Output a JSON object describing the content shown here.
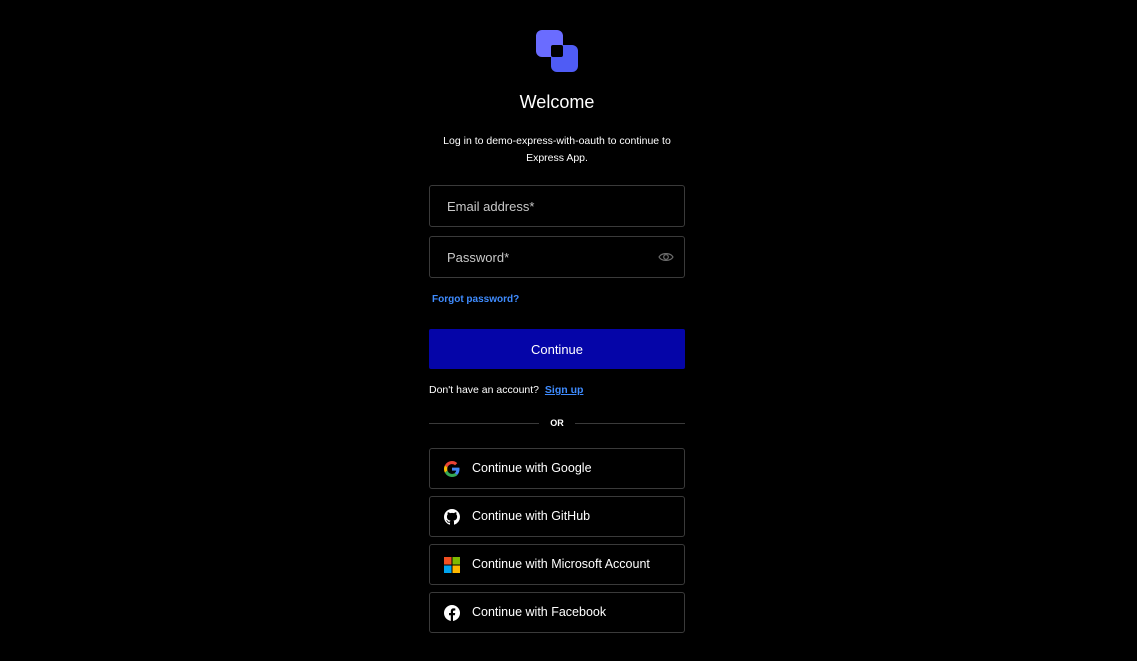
{
  "header": {
    "title": "Welcome",
    "subtitle_line1": "Log in to demo-express-with-oauth to continue to",
    "subtitle_line2": "Express App."
  },
  "form": {
    "email_placeholder": "Email address*",
    "email_value": "",
    "password_placeholder": "Password*",
    "password_value": "",
    "forgot_label": "Forgot password?",
    "continue_label": "Continue"
  },
  "signup": {
    "prompt": "Don't have an account?",
    "link_label": "Sign up"
  },
  "divider": {
    "label": "OR"
  },
  "social": {
    "google_label": "Continue with Google",
    "github_label": "Continue with GitHub",
    "microsoft_label": "Continue with Microsoft Account",
    "facebook_label": "Continue with Facebook"
  },
  "icons": {
    "logo": "app-logo-icon",
    "eye": "eye-icon",
    "google": "google-icon",
    "github": "github-icon",
    "microsoft": "microsoft-icon",
    "facebook": "facebook-icon"
  },
  "colors": {
    "background": "#000000",
    "primary_button": "#0505a8",
    "link": "#3f8cff",
    "logo": "#6a6cff"
  }
}
